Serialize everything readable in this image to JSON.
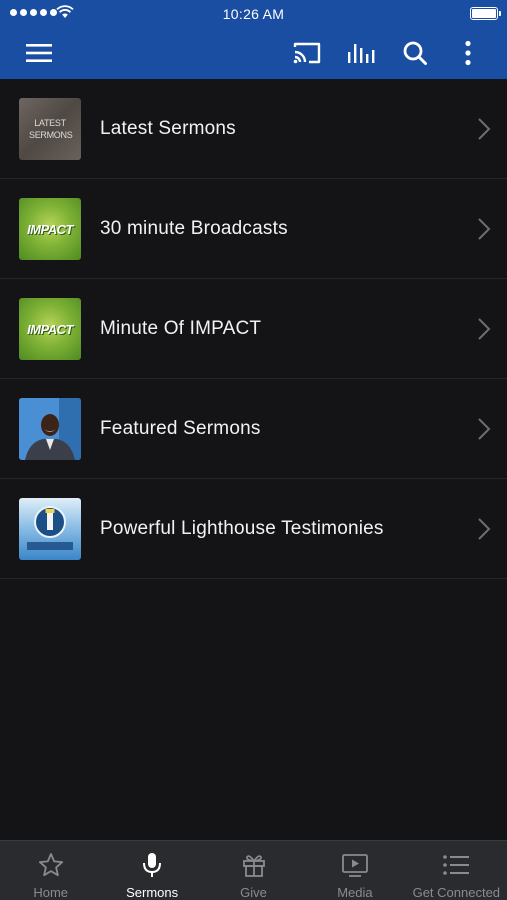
{
  "status_bar": {
    "time": "10:26 AM"
  },
  "toolbar": {
    "icons": [
      "menu-icon",
      "cast-icon",
      "audio-bars-icon",
      "search-icon",
      "more-vertical-icon"
    ]
  },
  "list": {
    "items": [
      {
        "label": "Latest Sermons",
        "thumb_text": "LATEST SERMONS"
      },
      {
        "label": "30 minute Broadcasts",
        "thumb_text": "IMPACT"
      },
      {
        "label": "Minute Of IMPACT",
        "thumb_text": "IMPACT"
      },
      {
        "label": "Featured Sermons"
      },
      {
        "label": "Powerful Lighthouse Testimonies"
      }
    ]
  },
  "tabbar": {
    "tabs": [
      {
        "label": "Home",
        "icon": "star-icon",
        "active": false
      },
      {
        "label": "Sermons",
        "icon": "microphone-icon",
        "active": true
      },
      {
        "label": "Give",
        "icon": "gift-icon",
        "active": false
      },
      {
        "label": "Media",
        "icon": "video-icon",
        "active": false
      },
      {
        "label": "Get Connected",
        "icon": "list-icon",
        "active": false
      }
    ]
  },
  "colors": {
    "header": "#1a4ea2",
    "background": "#141416",
    "tabbar": "#2a2b2e",
    "active_tab": "#ffffff",
    "inactive_tab": "#8a8b8f"
  }
}
